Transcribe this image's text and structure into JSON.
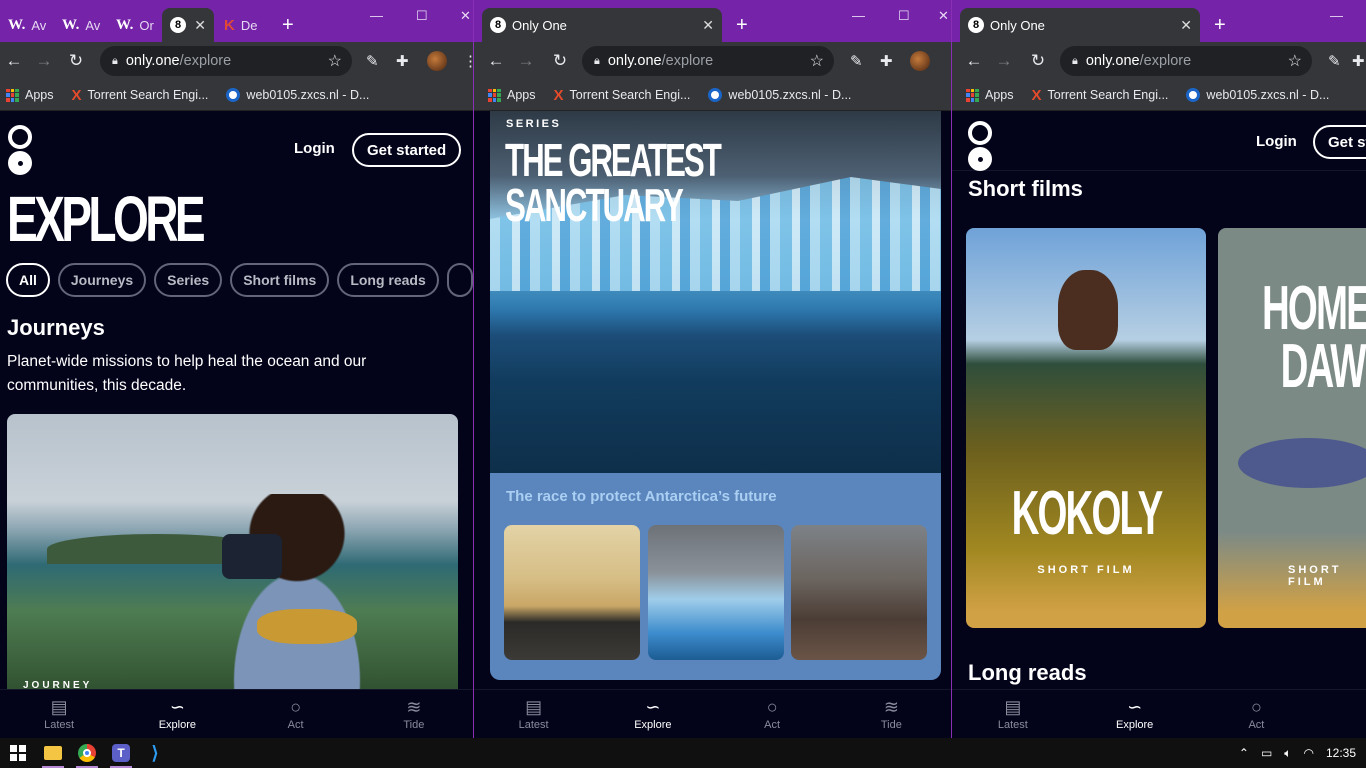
{
  "windows": [
    {
      "tabs": [
        {
          "icon": "W.",
          "label": "Av"
        },
        {
          "icon": "W.",
          "label": "Av"
        },
        {
          "icon": "W.",
          "label": "Or"
        },
        {
          "icon": "8",
          "label": "",
          "active": true
        },
        {
          "icon": "K",
          "label": "De"
        }
      ],
      "address": {
        "host": "only.one",
        "path": "/explore"
      },
      "page": {
        "login": "Login",
        "get_started": "Get started",
        "heading": "EXPLORE",
        "filters": [
          "All",
          "Journeys",
          "Series",
          "Short films",
          "Long reads",
          ""
        ],
        "section_title": "Journeys",
        "section_desc": "Planet-wide missions to help heal the ocean and our communities, this decade.",
        "card_label": "JOURNEY"
      }
    },
    {
      "tabs": [
        {
          "icon": "8",
          "label": "Only One",
          "active": true
        }
      ],
      "address": {
        "host": "only.one",
        "path": "/explore"
      },
      "page": {
        "series_label": "SERIES",
        "series_title_1": "THE GREATEST",
        "series_title_2": "SANCTUARY",
        "series_subtitle": "The race to protect Antarctica’s future"
      }
    },
    {
      "tabs": [
        {
          "icon": "8",
          "label": "Only One",
          "active": true
        }
      ],
      "address": {
        "host": "only.one",
        "path": "/explore"
      },
      "page": {
        "login": "Login",
        "get_started": "Get st",
        "section_title": "Short films",
        "films": [
          {
            "title": "KOKOLY",
            "label": "SHORT FILM"
          },
          {
            "title_1": "HOME A",
            "title_2": "DAWI",
            "label": "SHORT FILM"
          }
        ],
        "next_section": "Long reads"
      }
    }
  ],
  "bookmarks": [
    {
      "label": "Apps"
    },
    {
      "label": "Torrent Search Engi..."
    },
    {
      "label": "web0105.zxcs.nl - D..."
    }
  ],
  "bottom_nav": [
    "Latest",
    "Explore",
    "Act",
    "Tide"
  ],
  "taskbar": {
    "time": "12:35"
  },
  "colors": {
    "tabbar": "#7523a8",
    "page_bg": "#03041a",
    "series_card": "#5b86bd",
    "film_bar": "#d1a145"
  }
}
